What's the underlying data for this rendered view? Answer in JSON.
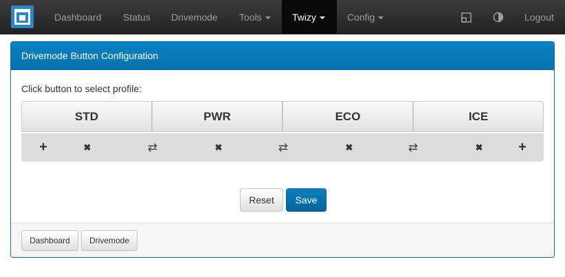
{
  "navbar": {
    "items": [
      {
        "label": "Dashboard"
      },
      {
        "label": "Status"
      },
      {
        "label": "Drivemode"
      },
      {
        "label": "Tools"
      },
      {
        "label": "Twizy"
      },
      {
        "label": "Config"
      }
    ],
    "icons": {
      "window": "window-icon",
      "contrast": "contrast-icon"
    },
    "logout_label": "Logout"
  },
  "panel": {
    "title": "Drivemode Button Configuration",
    "instruction": "Click button to select profile:",
    "profiles": [
      {
        "label": "STD"
      },
      {
        "label": "PWR"
      },
      {
        "label": "ECO"
      },
      {
        "label": "ICE"
      }
    ],
    "controls": {
      "add": "+",
      "remove": "✖",
      "swap": "⇄"
    },
    "reset_label": "Reset",
    "save_label": "Save",
    "footer": {
      "dashboard_label": "Dashboard",
      "drivemode_label": "Drivemode"
    }
  },
  "colors": {
    "navbar_bg": "#222222",
    "accent": "#0670ad",
    "panel_border": "#0d6ea5"
  }
}
